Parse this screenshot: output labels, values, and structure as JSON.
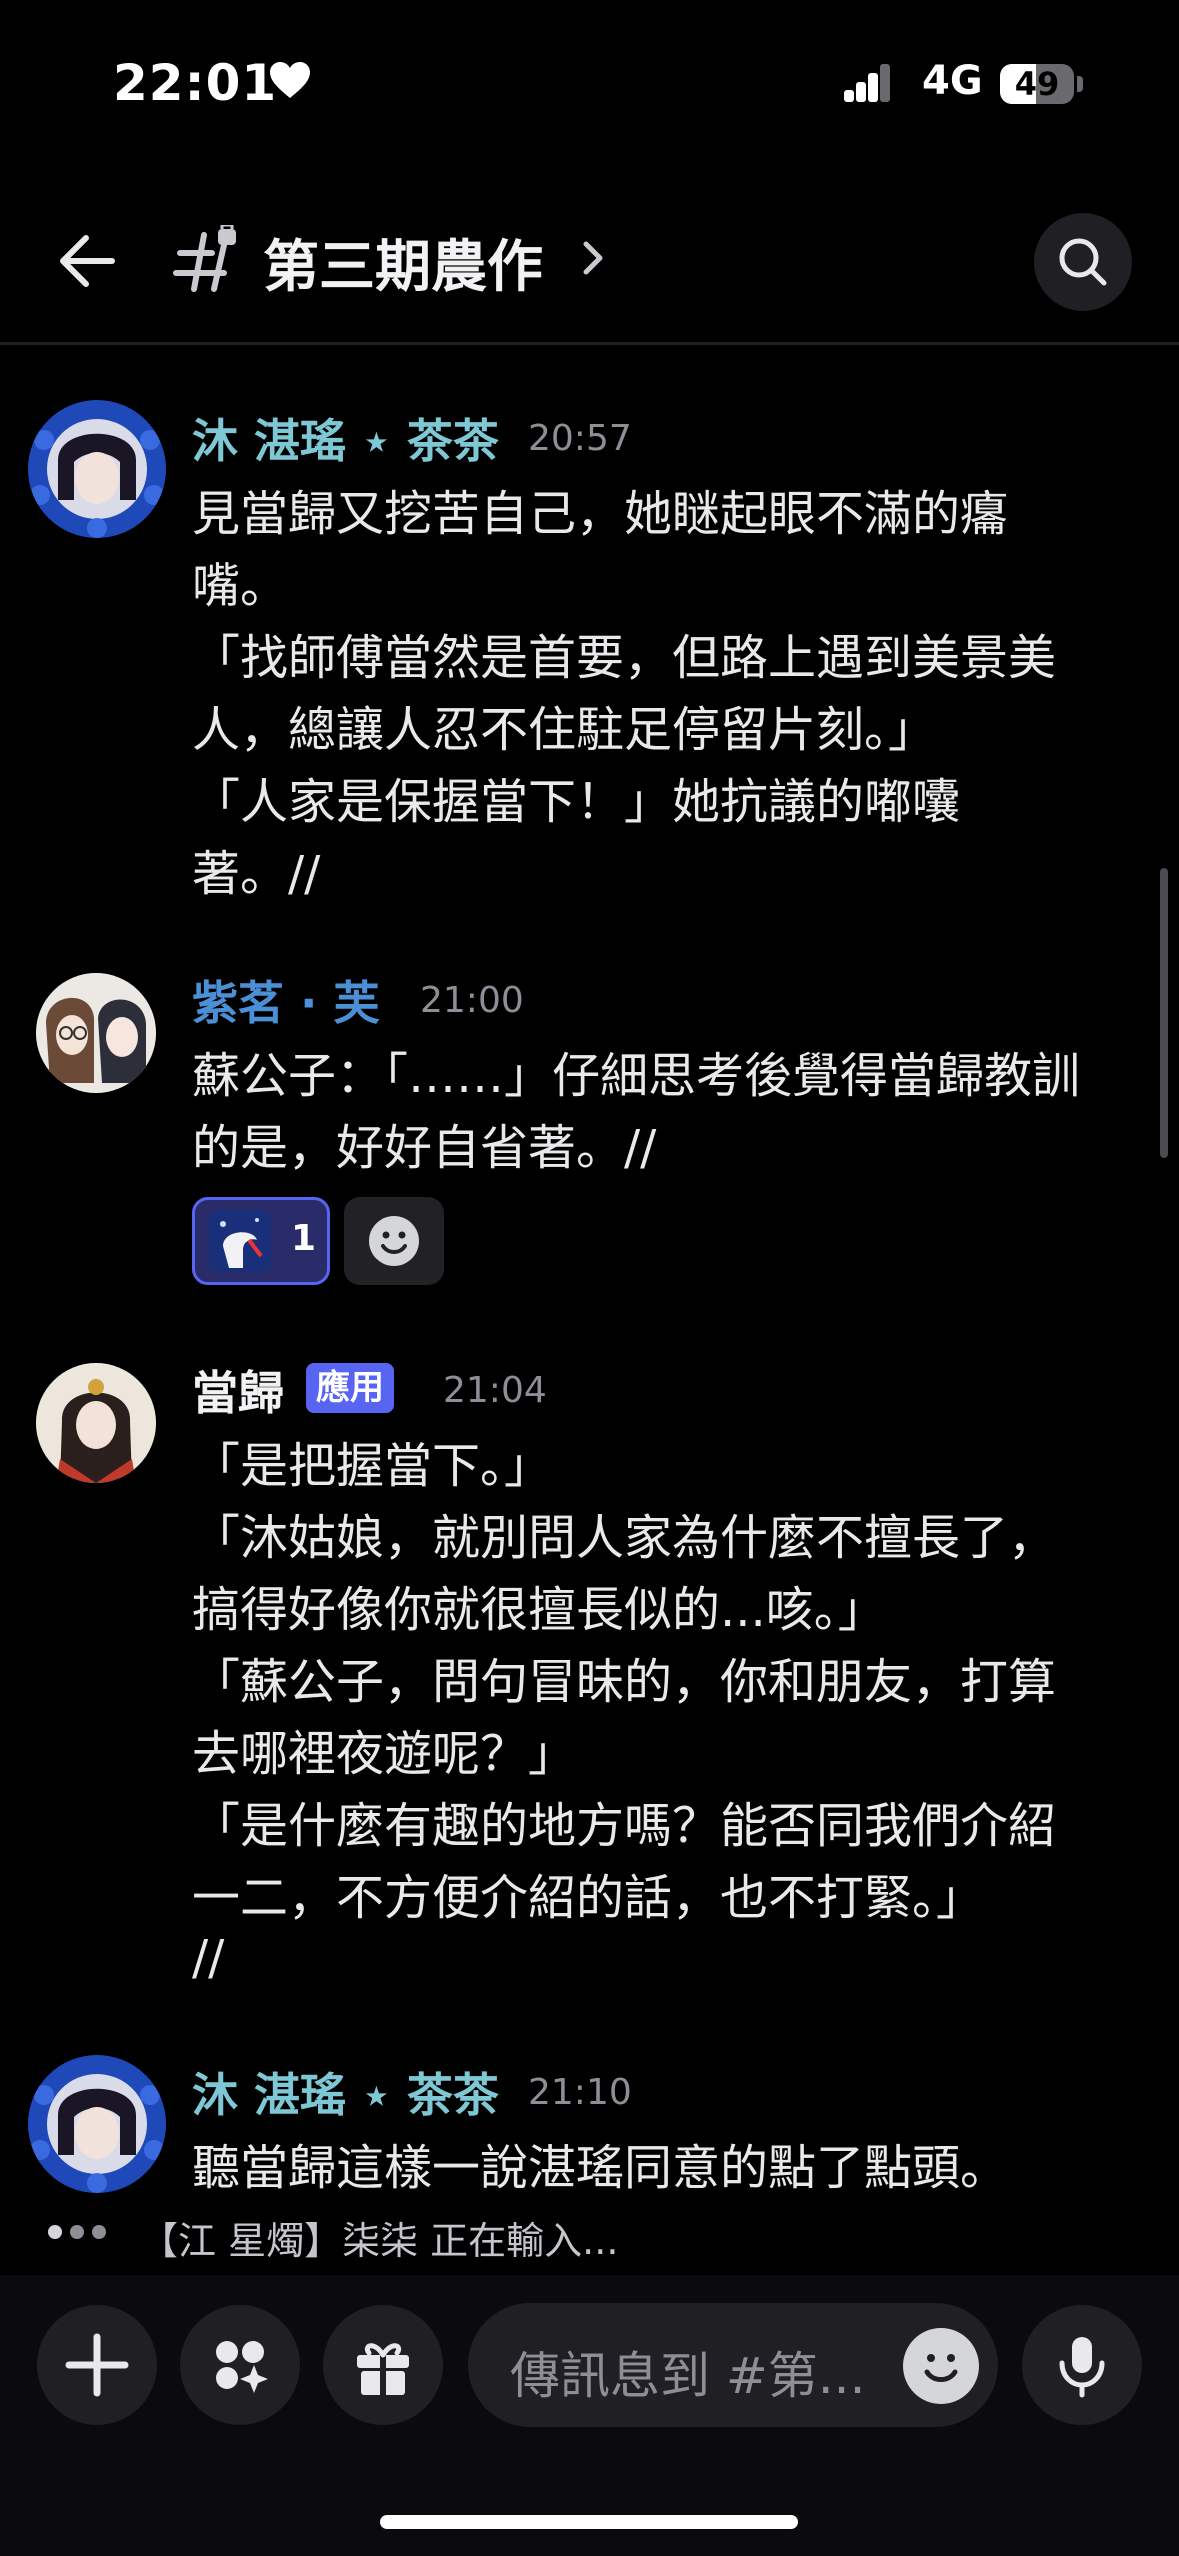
{
  "status_bar": {
    "time": "22:01",
    "network": "4G",
    "battery": "49"
  },
  "header": {
    "channel_name": "第三期農作"
  },
  "messages": [
    {
      "author": "沐 湛瑤 ⋆ 茶茶",
      "author_color": "#7ec8d6",
      "time": "20:57",
      "lines": [
        "見當歸又挖苦自己，她瞇起眼不滿的癟",
        "嘴。",
        "「找師傅當然是首要，但路上遇到美景美",
        "人，總讓人忍不住駐足停留片刻。」",
        "「人家是保握當下！」她抗議的嘟囔",
        "著。//"
      ]
    },
    {
      "author": "紫茗 · 芙",
      "author_color": "#4b8fd6",
      "time": "21:00",
      "lines": [
        "蘇公子：「……」仔細思考後覺得當歸教訓",
        "的是，好好自省著。//"
      ],
      "reaction_count": "1"
    },
    {
      "author": "當歸",
      "author_color": "#f2f2f5",
      "badge": "應用",
      "time": "21:04",
      "lines": [
        "「是把握當下。」",
        "「沐姑娘，就別問人家為什麼不擅長了，",
        "搞得好像你就很擅長似的...咳。」",
        "「蘇公子，問句冒昧的，你和朋友，打算",
        "去哪裡夜遊呢？」",
        "「是什麼有趣的地方嗎？能否同我們介紹",
        "一二，不方便介紹的話，也不打緊。」",
        "//"
      ]
    },
    {
      "author": "沐 湛瑤 ⋆ 茶茶",
      "author_color": "#7ec8d6",
      "time": "21:10",
      "lines": [
        "聽當歸這樣一說湛瑤同意的點了點頭。"
      ]
    }
  ],
  "typing": {
    "text": "【江 星燭】柒柒 正在輸入..."
  },
  "composer": {
    "placeholder": "傳訊息到 #第..."
  },
  "icons": [
    "back-arrow-icon",
    "channel-thread-icon",
    "search-icon",
    "plus-icon",
    "apps-icon",
    "gift-icon",
    "emoji-icon",
    "microphone-icon"
  ]
}
